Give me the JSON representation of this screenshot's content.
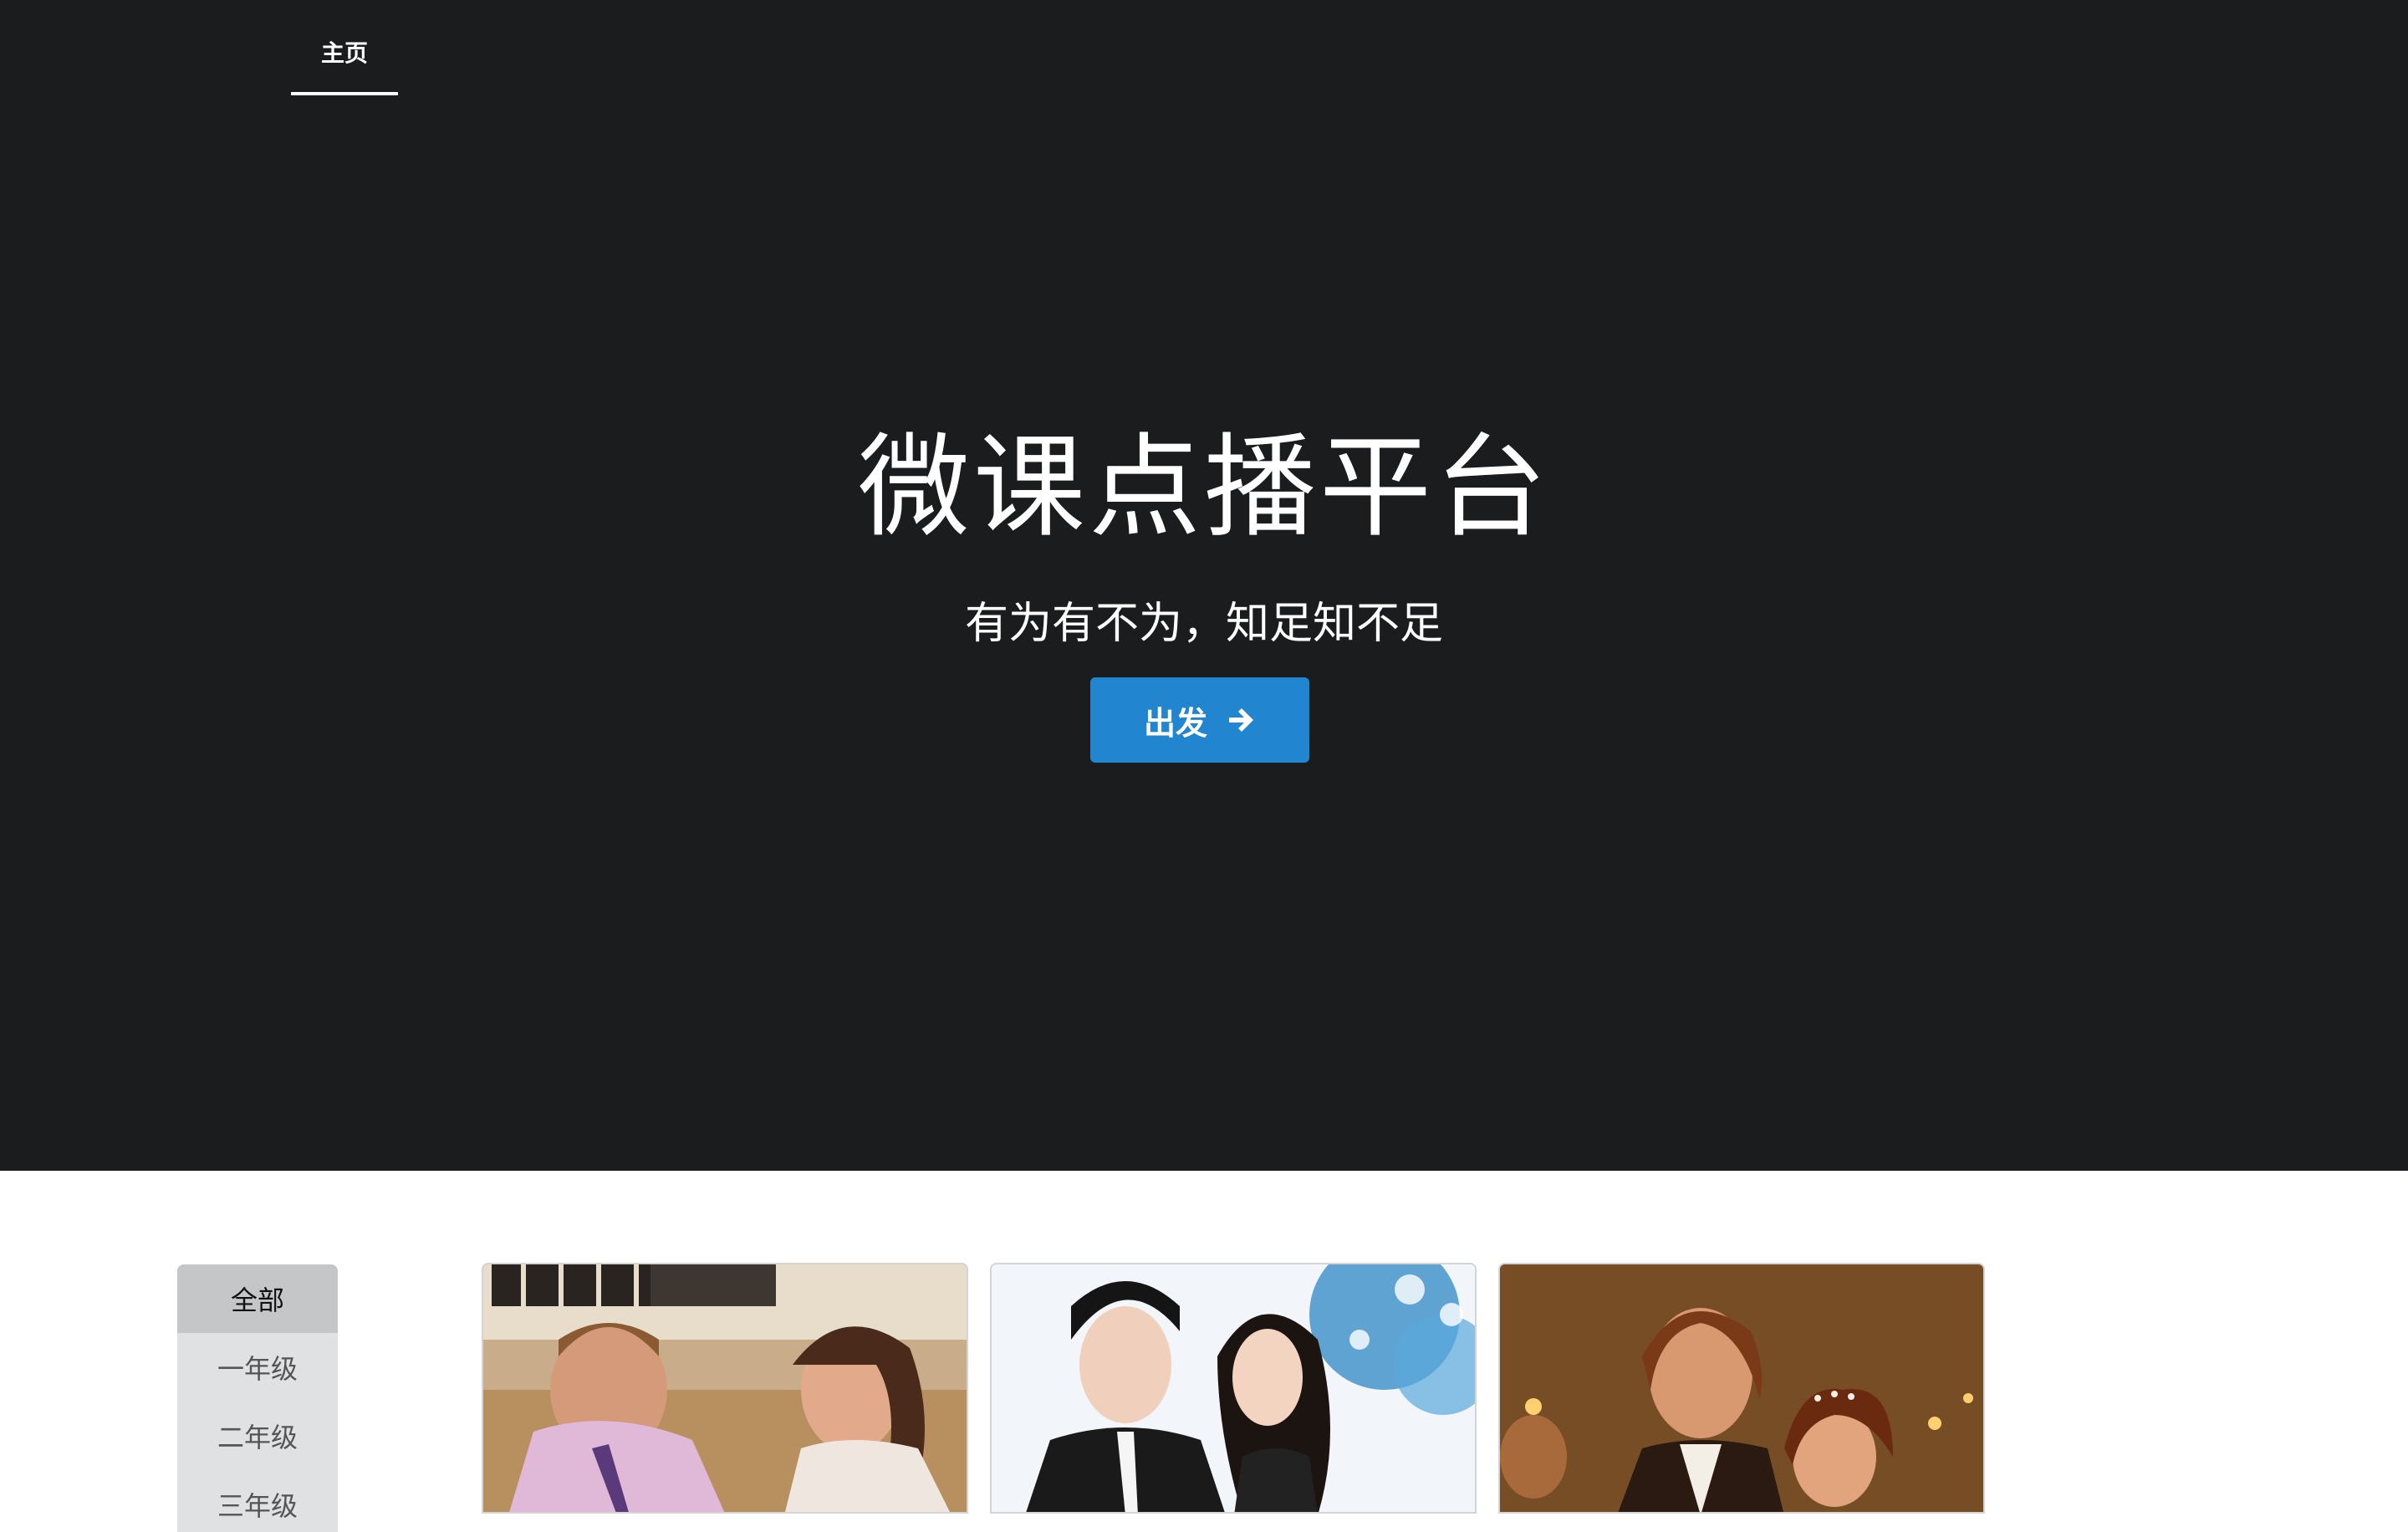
{
  "nav": {
    "home_label": "主页"
  },
  "hero": {
    "title": "微课点播平台",
    "subtitle": "有为有不为，知足知不足",
    "button_label": "出发",
    "button_icon": "arrow-right-icon",
    "background_color": "#1b1c1d",
    "button_color": "#2185d0"
  },
  "sidebar": {
    "items": [
      {
        "label": "全部",
        "active": true
      },
      {
        "label": "一年级",
        "active": false
      },
      {
        "label": "二年级",
        "active": false
      },
      {
        "label": "三年级",
        "active": false
      }
    ]
  },
  "courses": [
    {
      "thumbnail": "course-thumbnail-1"
    },
    {
      "thumbnail": "course-thumbnail-2"
    },
    {
      "thumbnail": "course-thumbnail-3"
    }
  ]
}
